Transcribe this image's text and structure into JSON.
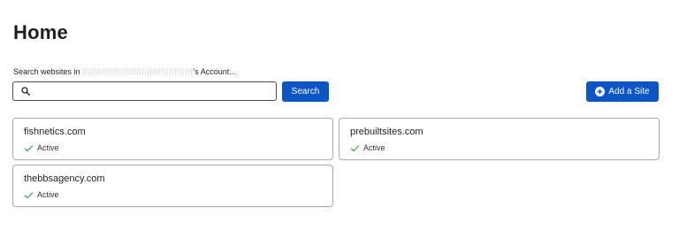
{
  "header": {
    "title": "Home"
  },
  "search": {
    "label_prefix": "Search websites in",
    "label_suffix": "'s Account...",
    "value": "",
    "placeholder": "",
    "button_label": "Search",
    "icon": "search-icon"
  },
  "actions": {
    "add_site_label": "Add a Site",
    "add_site_icon": "plus-circle-icon"
  },
  "sites": [
    {
      "name": "fishnetics.com",
      "status": "Active"
    },
    {
      "name": "prebuiltsites.com",
      "status": "Active"
    },
    {
      "name": "thebbsagency.com",
      "status": "Active"
    }
  ],
  "colors": {
    "primary": "#0b55c6",
    "status_active": "#2fa84f",
    "card_border": "#a9a9a9"
  }
}
